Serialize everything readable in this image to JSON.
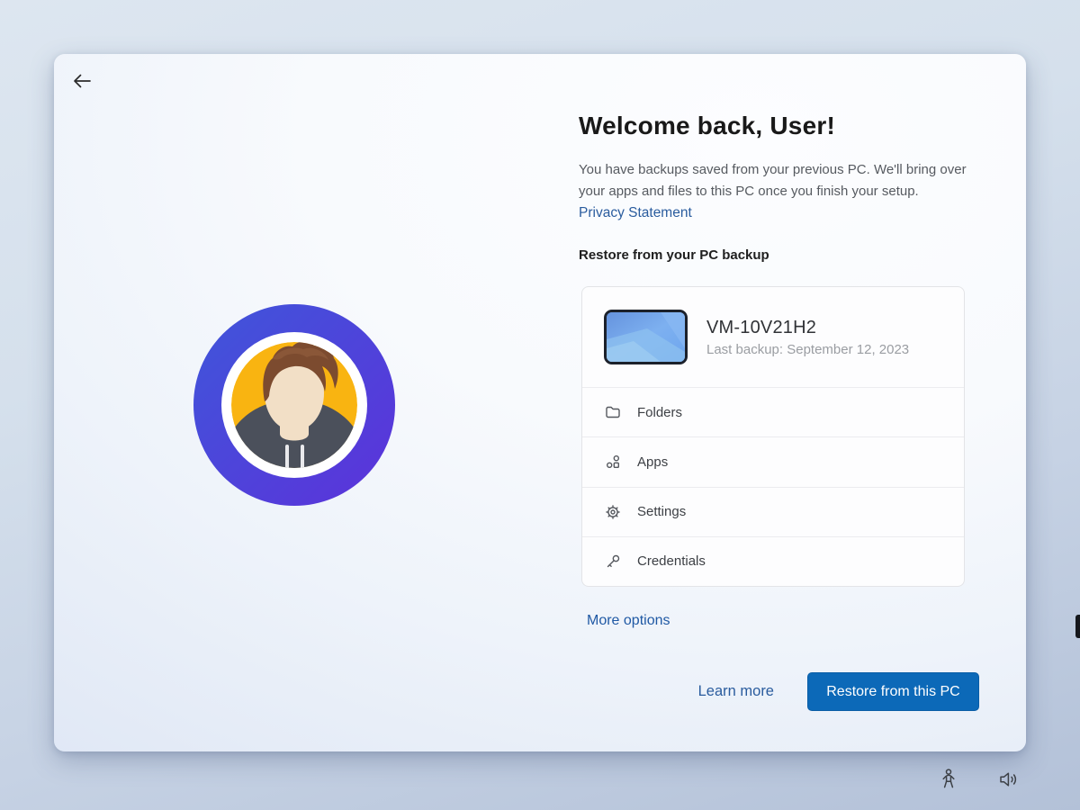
{
  "header": {
    "title": "Welcome back, User!",
    "description": "You have backups saved from your previous PC. We'll bring over your apps and files to this PC once you finish your setup.",
    "privacy_link": "Privacy Statement",
    "section_label": "Restore from your PC backup"
  },
  "backup_card": {
    "device_name": "VM-10V21H2",
    "last_backup": "Last backup: September 12, 2023",
    "items": [
      {
        "icon": "folder-icon",
        "label": "Folders"
      },
      {
        "icon": "apps-icon",
        "label": "Apps"
      },
      {
        "icon": "settings-icon",
        "label": "Settings"
      },
      {
        "icon": "key-icon",
        "label": "Credentials"
      }
    ]
  },
  "links": {
    "more_options": "More options",
    "learn_more": "Learn more"
  },
  "actions": {
    "primary_button": "Restore from this PC"
  },
  "icons": {
    "back": "back-arrow-icon",
    "tray": [
      "accessibility-icon",
      "volume-icon"
    ]
  },
  "colors": {
    "accent_button": "#0c69b8",
    "link_blue": "#2a5c9e",
    "avatar_ring_start": "#3f56da",
    "avatar_ring_end": "#5c32da",
    "avatar_yellow": "#f9b411",
    "hoodie": "#4b505b",
    "skin": "#f2dfc6",
    "hair": "#7c4b2f"
  }
}
